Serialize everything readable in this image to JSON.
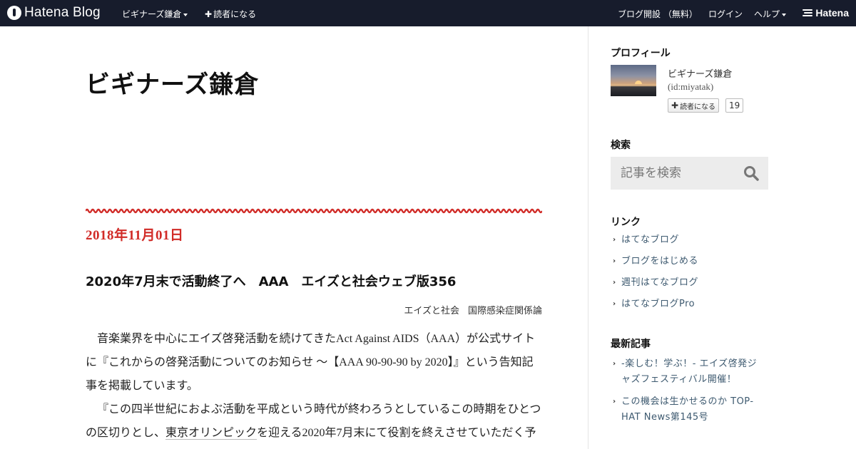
{
  "topbar": {
    "logo": "Hatena Blog",
    "blog_menu": "ビギナーズ鎌倉",
    "subscribe": "読者になる",
    "start_blog": "ブログ開設 （無料）",
    "login": "ログイン",
    "help": "ヘルプ",
    "brand": "Hatena"
  },
  "blog": {
    "title": "ビギナーズ鎌倉"
  },
  "entry": {
    "date": "2018年11月01日",
    "title": "2020年7月末で活動終了へ　AAA　エイズと社会ウェブ版356",
    "categories": [
      "エイズと社会",
      "国際感染症関係論"
    ],
    "paragraph1": "音楽業界を中心にエイズ啓発活動を続けてきたAct Against AIDS（AAA）が公式サイトに『これからの啓発活動についてのお知らせ ～【AAA 90-90-90 by 2020】』という告知記事を掲載しています。",
    "paragraph2_before": "『この四半世紀におよぶ活動を平成という時代が終わろうとしているこの時期をひとつの区切りとし、",
    "paragraph2_link": "東京オリンピック",
    "paragraph2_after": "を迎える2020年7月末にて役割を終えさせていただく予"
  },
  "sidebar": {
    "profile_heading": "プロフィール",
    "profile_name": "ビギナーズ鎌倉",
    "profile_id": "(id:miyatak)",
    "subscribe_label": "読者になる",
    "subscriber_count": "19",
    "search_heading": "検索",
    "search_placeholder": "記事を検索",
    "links_heading": "リンク",
    "links": [
      "はてなブログ",
      "ブログをはじめる",
      "週刊はてなブログ",
      "はてなブログPro"
    ],
    "recent_heading": "最新記事",
    "recent": [
      "-楽しむ！学ぶ！- エイズ啓発ジャズフェスティバル開催！",
      "この機会は生かせるのか TOP-HAT News第145号"
    ]
  },
  "colors": {
    "topbar_bg": "#171c2c",
    "date_red": "#d12b27",
    "link_blue": "#3e5a70"
  }
}
